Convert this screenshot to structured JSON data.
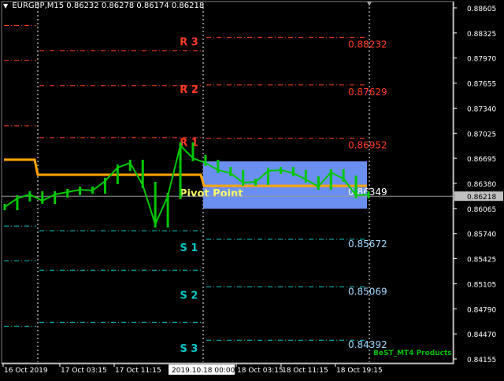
{
  "header": {
    "symbol_timeframe": "EURGBP,M15",
    "ohlc": "0.86232 0.86278 0.86174 0.86218",
    "dropdown_icon": "triangle-down-icon"
  },
  "watermark": "BeST_MT4 Products",
  "colors": {
    "background": "#000000",
    "candles": "#00c800",
    "resistance": "#ff3c1e",
    "support": "#00c8c8",
    "pivot": "#ffa500",
    "pivot_zone": "#6b8ff0",
    "watermark": "#00c000",
    "axis": "#ffffff",
    "session_sep": "#ffffff"
  },
  "levels": [
    {
      "id": "r3",
      "label": "R 3",
      "value": "0.88232",
      "kind": "resistance"
    },
    {
      "id": "r2",
      "label": "R 2",
      "value": "0.87629",
      "kind": "resistance"
    },
    {
      "id": "r1",
      "label": "R 1",
      "value": "0.86952",
      "kind": "resistance"
    },
    {
      "id": "pp",
      "label": "Pivot Point",
      "value": "0.86349",
      "kind": "pivot"
    },
    {
      "id": "s1",
      "label": "S 1",
      "value": "0.85672",
      "kind": "support"
    },
    {
      "id": "s2",
      "label": "S 2",
      "value": "0.85069",
      "kind": "support"
    },
    {
      "id": "s3",
      "label": "S 3",
      "value": "0.84392",
      "kind": "support"
    }
  ],
  "prev_day_levels": {
    "r3": 0.8838,
    "r2": 0.8794,
    "r1": 0.8711,
    "pp": 0.8667,
    "s1": 0.8584,
    "s2": 0.854,
    "s3": 0.8457
  },
  "pp_prev": 0.8662,
  "chart_data": {
    "type": "line",
    "series": [
      {
        "x": [
          "16 Oct 2019",
          "16 Oct 2019",
          "16 Oct 2019",
          "16 Oct 2019",
          "17 Oct 03:15",
          "17 Oct 03:15",
          "17 Oct 03:15",
          "17 Oct 03:15",
          "17 Oct 03:15",
          "17 Oct 11:15",
          "17 Oct 11:15",
          "17 Oct 11:15",
          "17 Oct 11:15",
          "17 Oct 11:15",
          "17 Oct 11:15",
          "17 Oct 11:15",
          "17 Oct 11:15",
          "17 Oct 11:15",
          "17 Oct 11:15",
          "2019.10.18 00:00",
          "2019.10.18 00:00",
          "18 Oct 03:15",
          "18 Oct 03:15",
          "18 Oct 03:15",
          "18 Oct 11:15",
          "18 Oct 11:15",
          "18 Oct 11:15",
          "18 Oct 11:15",
          "18 Oct 19:15",
          "18 Oct 19:15"
        ],
        "values": [
          0.8608,
          0.8619,
          0.8624,
          0.8616,
          0.8624,
          0.8627,
          0.863,
          0.8629,
          0.8641,
          0.8658,
          0.8664,
          0.8636,
          0.8586,
          0.8622,
          0.8686,
          0.867,
          0.8664,
          0.8655,
          0.8651,
          0.8639,
          0.864,
          0.8654,
          0.8655,
          0.8651,
          0.8643,
          0.8634,
          0.8652,
          0.8644,
          0.8623,
          0.8624
        ]
      }
    ],
    "y_ticks": [
      "0.88605",
      "0.88325",
      "0.87970",
      "0.87655",
      "0.87340",
      "0.87025",
      "0.86695",
      "0.86380",
      "0.86065",
      "0.85740",
      "0.85425",
      "0.85105",
      "0.84790",
      "0.84470",
      "0.84155"
    ],
    "current_price": "0.86218",
    "x_ticks": [
      "16 Oct 2019",
      "17 Oct 03:15",
      "17 Oct 11:15",
      "2019.10.18 00:00",
      "18 Oct 03:15",
      "18 Oct 11:15",
      "18 Oct 19:15"
    ],
    "ylim": [
      0.84155,
      0.88605
    ]
  }
}
